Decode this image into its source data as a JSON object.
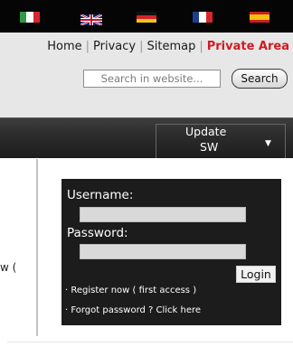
{
  "languages": [
    {
      "name": "italian-flag-icon",
      "colors": [
        "#2f9a45",
        "#ffffff",
        "#d7262d"
      ]
    },
    {
      "name": "english-flag-icon",
      "colors": [
        "#012169",
        "#ffffff",
        "#c8102e"
      ]
    },
    {
      "name": "german-flag-icon",
      "colors": [
        "#111111",
        "#d4232b",
        "#f2c31b"
      ]
    },
    {
      "name": "french-flag-icon",
      "colors": [
        "#1f3d8f",
        "#ffffff",
        "#d7262d"
      ]
    },
    {
      "name": "spanish-flag-icon",
      "colors": [
        "#c8201f",
        "#f4c20d",
        "#c8201f"
      ]
    }
  ],
  "header": {
    "links": [
      "Home",
      "Privacy",
      "Sitemap"
    ],
    "private_area": "Private Area",
    "search": {
      "placeholder": "Search in website...",
      "button": "Search"
    }
  },
  "nav": {
    "item_line1": "Update",
    "item_line2": "SW",
    "arrow_icon": "down-triangle-icon"
  },
  "side_text": "w (",
  "login": {
    "username_label": "Username:",
    "password_label": "Password:",
    "button": "Login",
    "register_link": "· Register now ( first access )",
    "forgot_link": "· Forgot password ? Click here"
  },
  "colors": {
    "accent_red": "#d01b22",
    "panel_bg": "#1c1c1c",
    "header_bg": "#e7e7e7"
  }
}
